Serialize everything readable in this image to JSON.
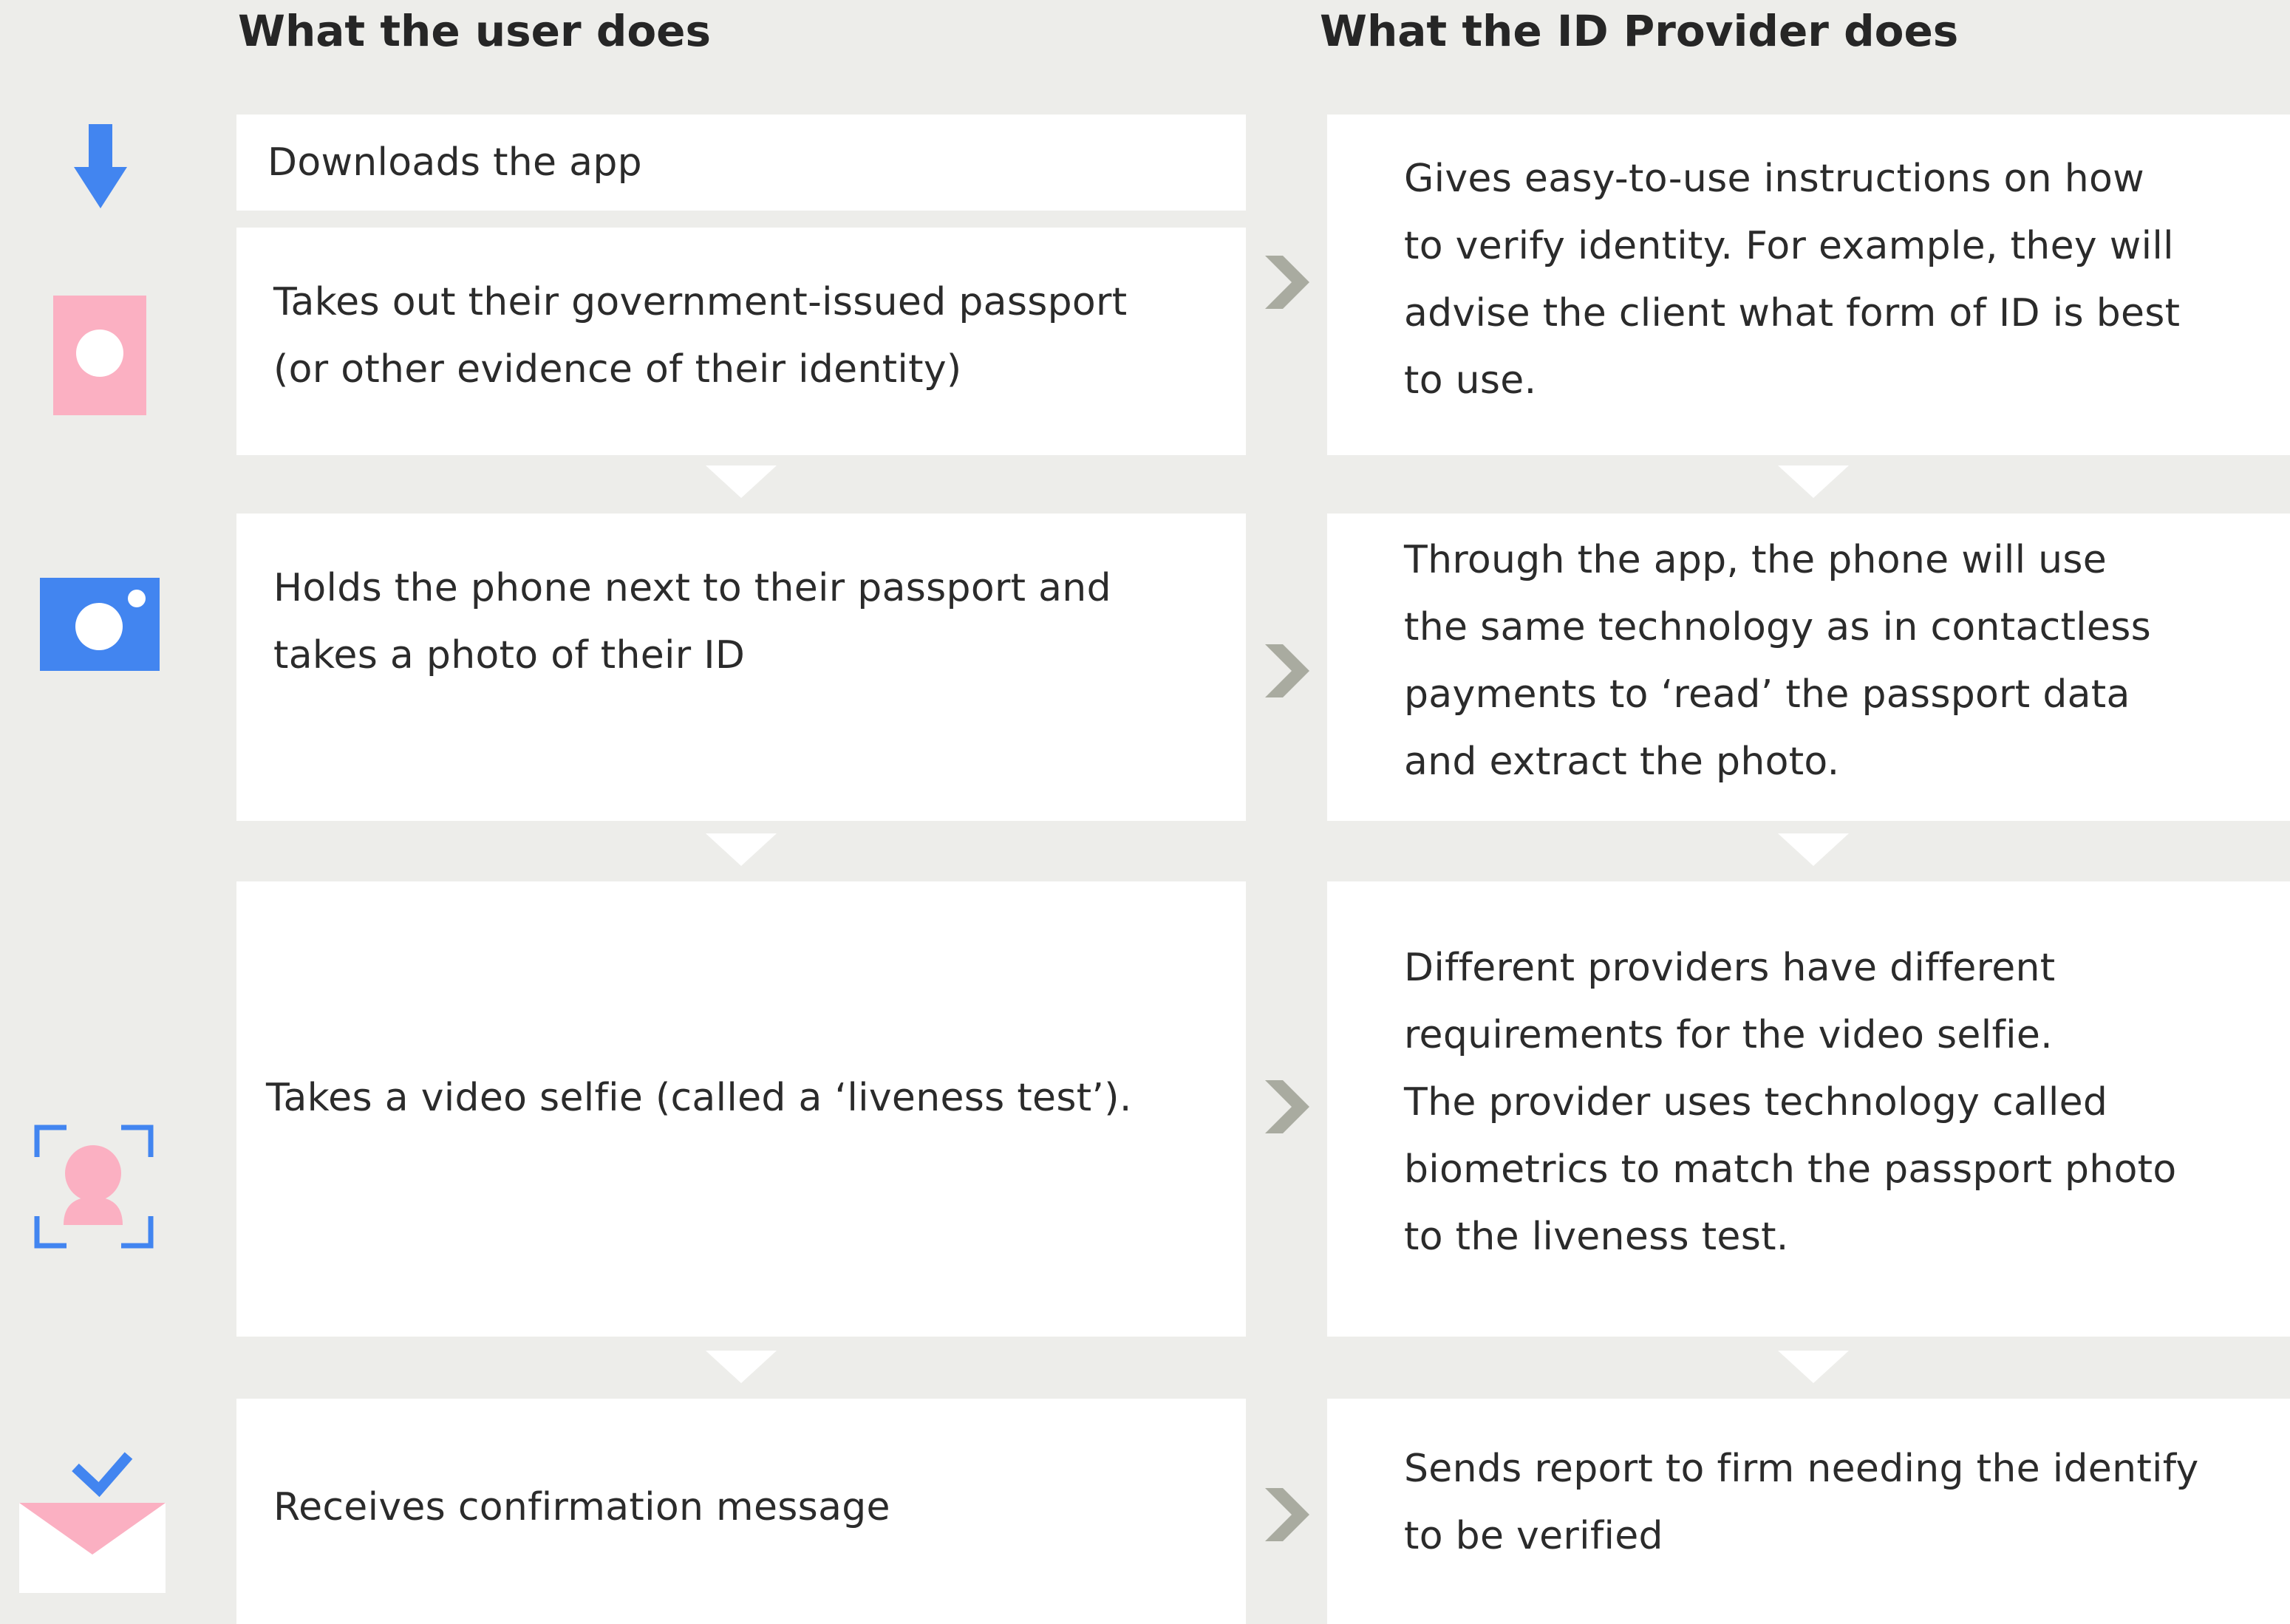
{
  "headers": {
    "user": "What the user does",
    "provider": "What the ID Provider does"
  },
  "steps": {
    "user": [
      "Downloads the app",
      "Takes out their government-issued passport\n(or other evidence of their identity)",
      "Holds the phone next to their passport and\ntakes a photo of their ID",
      "Takes a video selfie (called a ‘liveness test’).",
      "Receives confirmation message"
    ],
    "provider": [
      "Gives easy-to-use instructions on how\nto verify identity. For example, they will\nadvise the client what form of ID is best\nto use.",
      "Through the app, the phone will use\nthe same technology as in contactless\npayments to ‘read’ the passport data\nand extract the photo.",
      "Different providers have different\nrequirements for the video selfie.\nThe provider uses technology called\nbiometrics to match the passport photo\nto the liveness test.",
      "Sends report to firm needing the identify\nto be verified"
    ]
  },
  "icons": [
    "download-arrow-icon",
    "passport-icon",
    "camera-icon",
    "selfie-frame-icon",
    "confirmation-envelope-icon"
  ],
  "colors": {
    "background": "#ededea",
    "box": "#ffffff",
    "blue": "#4285f0",
    "pink": "#fbb0c2",
    "chevron": "#a9aba0"
  }
}
